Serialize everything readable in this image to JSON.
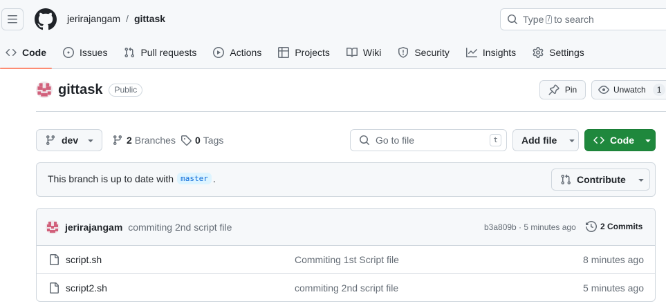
{
  "header": {
    "owner": "jerirajangam",
    "separator": "/",
    "repo": "gittask",
    "search": {
      "prefix": "Type",
      "key": "/",
      "suffix": "to search"
    }
  },
  "tabs": [
    {
      "label": "Code",
      "icon": "code-icon",
      "active": true
    },
    {
      "label": "Issues",
      "icon": "issue-icon"
    },
    {
      "label": "Pull requests",
      "icon": "pull-request-icon"
    },
    {
      "label": "Actions",
      "icon": "play-icon"
    },
    {
      "label": "Projects",
      "icon": "table-icon"
    },
    {
      "label": "Wiki",
      "icon": "book-icon"
    },
    {
      "label": "Security",
      "icon": "shield-icon"
    },
    {
      "label": "Insights",
      "icon": "graph-icon"
    },
    {
      "label": "Settings",
      "icon": "gear-icon"
    }
  ],
  "repo_title": {
    "name": "gittask",
    "visibility": "Public",
    "pin_label": "Pin",
    "watch_label": "Unwatch",
    "watch_count": "1"
  },
  "toolbar": {
    "branch": "dev",
    "branches_count": "2",
    "branches_label": "Branches",
    "tags_count": "0",
    "tags_label": "Tags",
    "goto_placeholder": "Go to file",
    "goto_key": "t",
    "add_file_label": "Add file",
    "code_label": "Code"
  },
  "branch_status": {
    "text": "This branch is up to date with",
    "branch": "master",
    "suffix": ".",
    "contribute_label": "Contribute"
  },
  "latest_commit": {
    "author": "jerirajangam",
    "message": "commiting 2nd script file",
    "meta": "b3a809b · 5 minutes ago",
    "commits_label": "2 Commits"
  },
  "files": [
    {
      "name": "script.sh",
      "message": "Commiting 1st Script file",
      "time": "8 minutes ago"
    },
    {
      "name": "script2.sh",
      "message": "commiting 2nd script file",
      "time": "5 minutes ago"
    }
  ],
  "colors": {
    "accent_tab_underline": "#fd8c73",
    "code_button": "#1f883d",
    "link_blue": "#0969da",
    "avatar": "#d1607b"
  }
}
